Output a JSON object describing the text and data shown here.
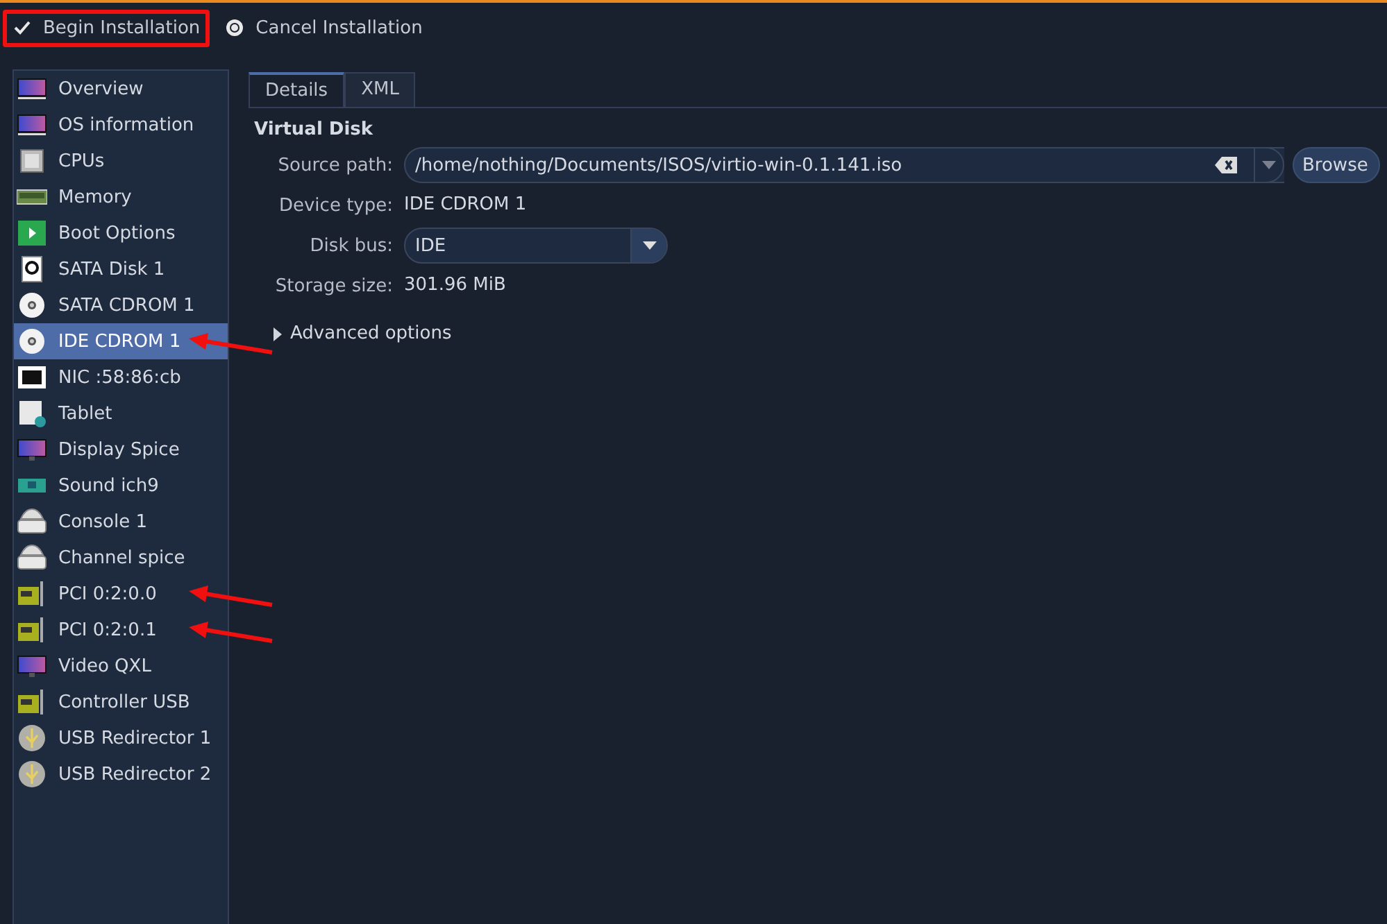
{
  "toolbar": [
    {
      "label": "Begin Installation",
      "kind": "check",
      "highlighted": true
    },
    {
      "label": "Cancel Installation",
      "kind": "radio",
      "highlighted": false
    }
  ],
  "sidebar": {
    "items": [
      {
        "label": "Overview",
        "kind": "monitor",
        "selected": false,
        "marked": false
      },
      {
        "label": "OS information",
        "kind": "monitor",
        "selected": false,
        "marked": false
      },
      {
        "label": "CPUs",
        "kind": "chip",
        "selected": false,
        "marked": false
      },
      {
        "label": "Memory",
        "kind": "memory",
        "selected": false,
        "marked": false
      },
      {
        "label": "Boot Options",
        "kind": "boot",
        "selected": false,
        "marked": false
      },
      {
        "label": "SATA Disk 1",
        "kind": "disk",
        "selected": false,
        "marked": false
      },
      {
        "label": "SATA CDROM 1",
        "kind": "cdrom",
        "selected": false,
        "marked": false
      },
      {
        "label": "IDE CDROM 1",
        "kind": "cdrom",
        "selected": true,
        "marked": true
      },
      {
        "label": "NIC :58:86:cb",
        "kind": "nic",
        "selected": false,
        "marked": false
      },
      {
        "label": "Tablet",
        "kind": "tablet",
        "selected": false,
        "marked": false
      },
      {
        "label": "Display Spice",
        "kind": "display",
        "selected": false,
        "marked": false
      },
      {
        "label": "Sound ich9",
        "kind": "sound",
        "selected": false,
        "marked": false
      },
      {
        "label": "Console 1",
        "kind": "console",
        "selected": false,
        "marked": false
      },
      {
        "label": "Channel spice",
        "kind": "console",
        "selected": false,
        "marked": false
      },
      {
        "label": "PCI 0:2:0.0",
        "kind": "pci",
        "selected": false,
        "marked": true
      },
      {
        "label": "PCI 0:2:0.1",
        "kind": "pci",
        "selected": false,
        "marked": true
      },
      {
        "label": "Video QXL",
        "kind": "display",
        "selected": false,
        "marked": false
      },
      {
        "label": "Controller USB",
        "kind": "pci",
        "selected": false,
        "marked": false
      },
      {
        "label": "USB Redirector 1",
        "kind": "usb",
        "selected": false,
        "marked": false
      },
      {
        "label": "USB Redirector 2",
        "kind": "usb",
        "selected": false,
        "marked": false
      }
    ]
  },
  "tabs": [
    {
      "label": "Details",
      "selected": true
    },
    {
      "label": "XML",
      "selected": false
    }
  ],
  "section": {
    "title": "Virtual Disk",
    "source_path": {
      "label": "Source path:",
      "value": "/home/nothing/Documents/ISOS/virtio-win-0.1.141.iso",
      "button": "Browse"
    },
    "device_type": {
      "label": "Device type:",
      "value": "IDE CDROM 1"
    },
    "disk_bus": {
      "label": "Disk bus:",
      "value": "IDE"
    },
    "storage_size": {
      "label": "Storage size:",
      "value": "301.96 MiB"
    },
    "advanced": {
      "label": "Advanced options",
      "expanded": false
    }
  }
}
